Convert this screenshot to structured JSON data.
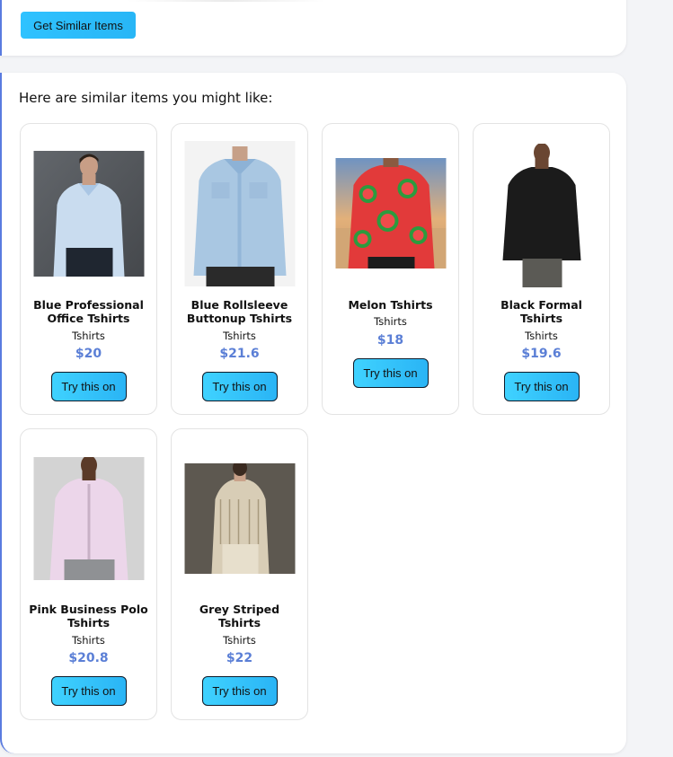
{
  "toolbar": {
    "similar_label": "Get Similar Items"
  },
  "results": {
    "intro": "Here are similar items you might like:",
    "products": [
      {
        "name": "Blue Professional Office Tshirts",
        "category": "Tshirts",
        "price": "$20",
        "button": "Try this on"
      },
      {
        "name": "Blue Rollsleeve Buttonup Tshirts",
        "category": "Tshirts",
        "price": "$21.6",
        "button": "Try this on"
      },
      {
        "name": "Melon Tshirts",
        "category": "Tshirts",
        "price": "$18",
        "button": "Try this on"
      },
      {
        "name": "Black Formal Tshirts",
        "category": "Tshirts",
        "price": "$19.6",
        "button": "Try this on"
      },
      {
        "name": "Pink Business Polo Tshirts",
        "category": "Tshirts",
        "price": "$20.8",
        "button": "Try this on"
      },
      {
        "name": "Grey Striped Tshirts",
        "category": "Tshirts",
        "price": "$22",
        "button": "Try this on"
      }
    ]
  },
  "colors": {
    "accent": "#5b7fd6",
    "button": "#2fc2ff",
    "border": "#5a7be0"
  }
}
